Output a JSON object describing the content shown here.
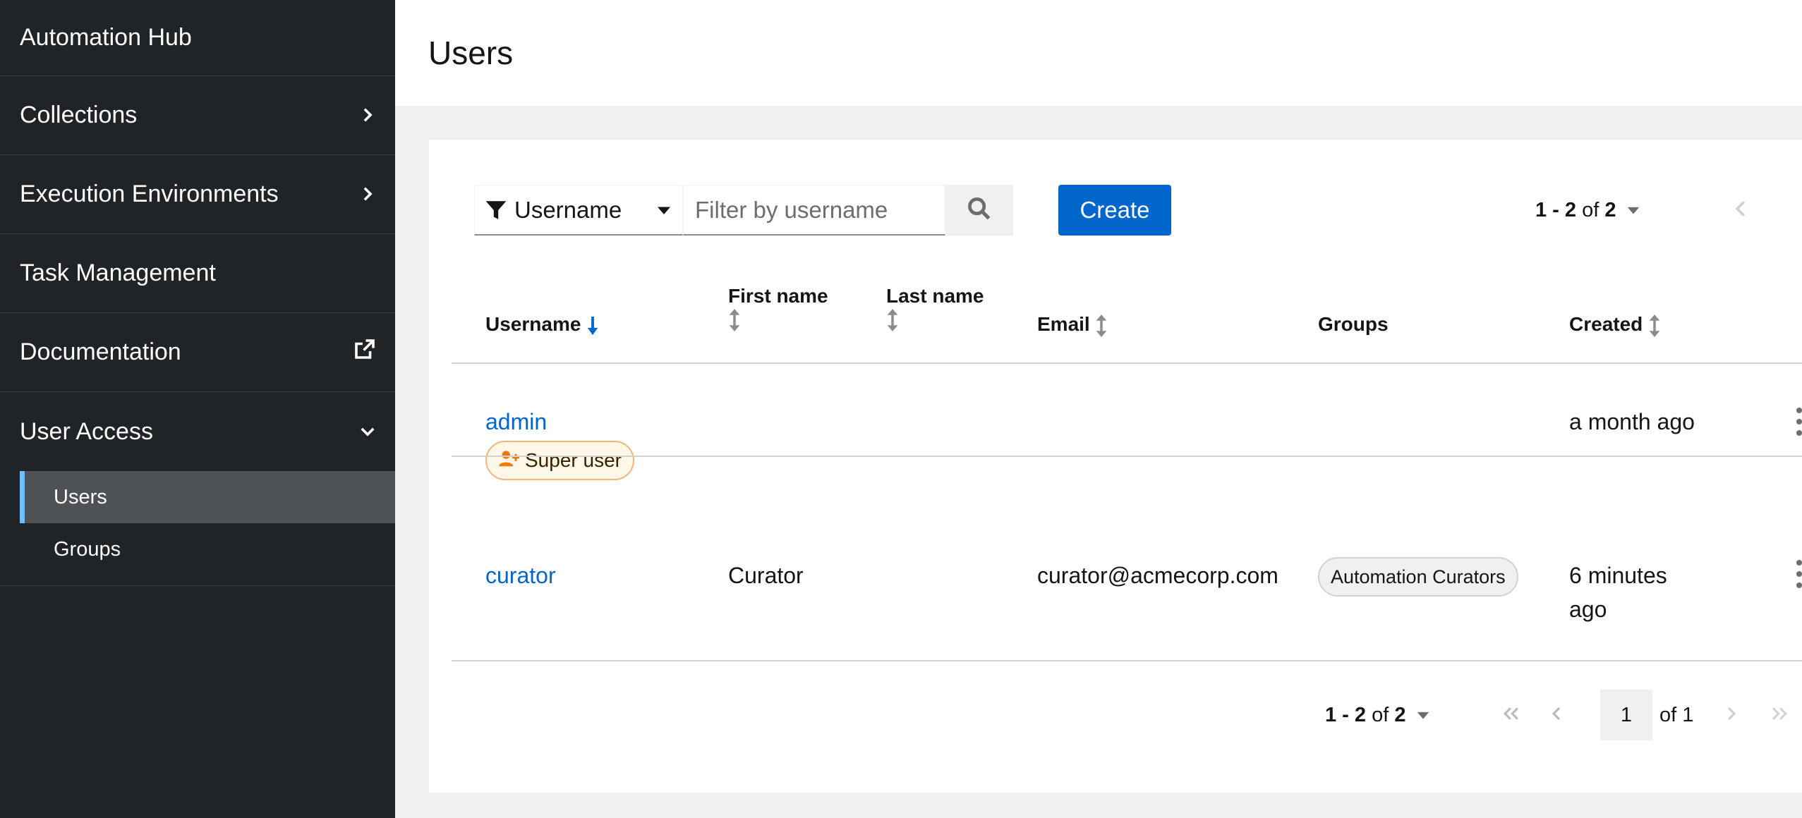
{
  "sidebar": {
    "title": "Automation Hub",
    "items": [
      {
        "label": "Collections"
      },
      {
        "label": "Execution Environments"
      },
      {
        "label": "Task Management"
      },
      {
        "label": "Documentation"
      },
      {
        "label": "User Access"
      }
    ],
    "sub_items": [
      {
        "label": "Users",
        "active": true
      },
      {
        "label": "Groups",
        "active": false
      }
    ]
  },
  "header": {
    "title": "Users"
  },
  "toolbar": {
    "filter_attribute": "Username",
    "filter_placeholder": "Filter by username",
    "create_label": "Create"
  },
  "pagination_top": {
    "range": "1 - 2",
    "of_word": "of",
    "total": "2"
  },
  "table": {
    "columns": [
      "Username",
      "First name",
      "Last name",
      "Email",
      "Groups",
      "Created"
    ],
    "rows": [
      {
        "username": "admin",
        "badge": "Super user",
        "first_name": "",
        "last_name": "",
        "email": "",
        "group": "",
        "created": "a month ago"
      },
      {
        "username": "curator",
        "badge": "",
        "first_name": "Curator",
        "last_name": "",
        "email": "curator@acmecorp.com",
        "group": "Automation Curators",
        "created_line1": "6 minutes",
        "created_line2": "ago"
      }
    ]
  },
  "pagination_bottom": {
    "range": "1 - 2",
    "of_word": "of",
    "total": "2",
    "current_page": "1",
    "of_pages": "of 1"
  },
  "colors": {
    "accent": "#0066cc",
    "sidebar_bg": "#212427",
    "active_border": "#73bcf7"
  }
}
